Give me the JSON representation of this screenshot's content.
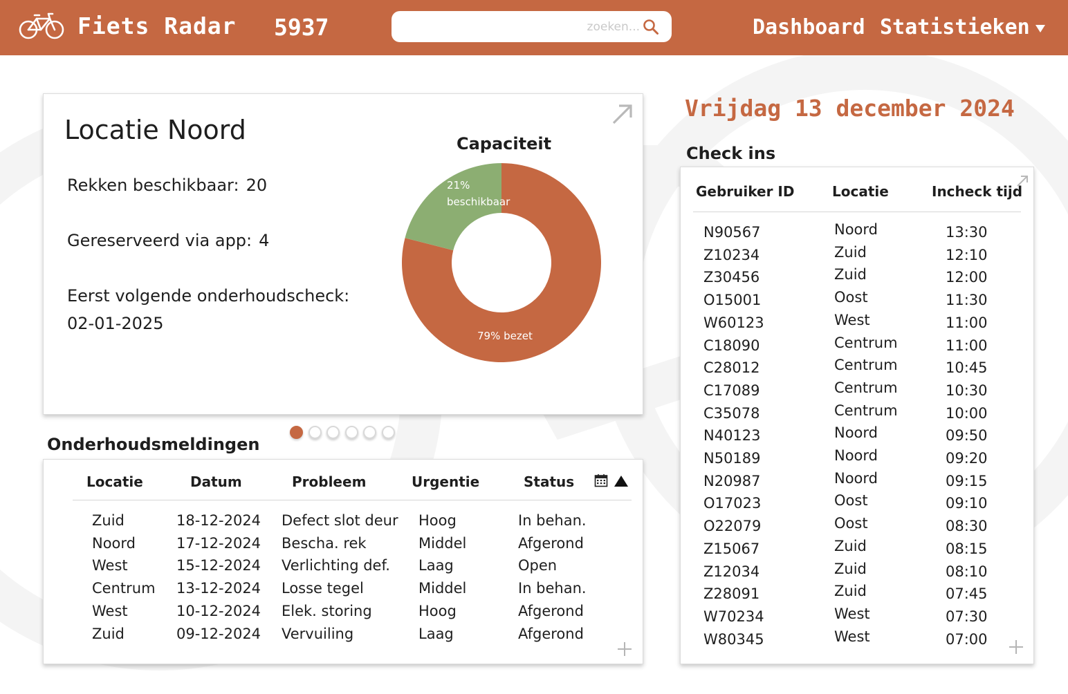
{
  "header": {
    "app_title": "Fiets Radar",
    "code": "5937",
    "search_placeholder": "zoeken...",
    "nav": {
      "dashboard": "Dashboard",
      "statistics": "Statistieken"
    },
    "logo_icon": "bicycle-icon",
    "search_icon": "magnifier-icon"
  },
  "colors": {
    "brand": "#c56842",
    "available": "#8cae72",
    "text": "#1e1e1e"
  },
  "date_heading": "Vrijdag 13 december 2024",
  "location_card": {
    "title": "Locatie Noord",
    "racks_label": "Rekken beschikbaar:",
    "racks_value": "20",
    "reserved_label": "Gereserveerd via app:",
    "reserved_value": "4",
    "maintenance_label": "Eerst volgende onderhoudscheck:",
    "maintenance_date": "02-01-2025",
    "carousel_pages": 6,
    "carousel_active_index": 0
  },
  "chart_data": {
    "type": "pie",
    "title": "Capaciteit",
    "slices": [
      {
        "label": "beschikbaar",
        "value": 21,
        "display_pct": "21%",
        "display_label": "beschikbaar",
        "color": "#8cae72"
      },
      {
        "label": "bezet",
        "value": 79,
        "display_label": "79% bezet",
        "color": "#c56842"
      }
    ]
  },
  "maintenance": {
    "title": "Onderhoudsmeldingen",
    "columns": [
      "Locatie",
      "Datum",
      "Probleem",
      "Urgentie",
      "Status"
    ],
    "rows": [
      [
        "Zuid",
        "18-12-2024",
        "Defect slot deur",
        "Hoog",
        "In behan."
      ],
      [
        "Noord",
        "17-12-2024",
        "Bescha. rek",
        "Middel",
        "Afgerond"
      ],
      [
        "West",
        "15-12-2024",
        "Verlichting def.",
        "Laag",
        "Open"
      ],
      [
        "Centrum",
        "13-12-2024",
        "Losse tegel",
        "Middel",
        "In behan."
      ],
      [
        "West",
        "10-12-2024",
        "Elek. storing",
        "Hoog",
        "Afgerond"
      ],
      [
        "Zuid",
        "09-12-2024",
        "Vervuiling",
        "Laag",
        "Afgerond"
      ]
    ]
  },
  "checkins": {
    "title": "Check ins",
    "columns": [
      "Gebruiker ID",
      "Locatie",
      "Incheck tijd"
    ],
    "rows": [
      [
        "N90567",
        "Noord",
        "13:30"
      ],
      [
        "Z10234",
        "Zuid",
        "12:10"
      ],
      [
        "Z30456",
        "Zuid",
        "12:00"
      ],
      [
        "O15001",
        "Oost",
        "11:30"
      ],
      [
        "W60123",
        "West",
        "11:00"
      ],
      [
        "C18090",
        "Centrum",
        "11:00"
      ],
      [
        "C28012",
        "Centrum",
        "10:45"
      ],
      [
        "C17089",
        "Centrum",
        "10:30"
      ],
      [
        "C35078",
        "Centrum",
        "10:00"
      ],
      [
        "N40123",
        "Noord",
        "09:50"
      ],
      [
        "N50189",
        "Noord",
        "09:20"
      ],
      [
        "N20987",
        "Noord",
        "09:15"
      ],
      [
        "O17023",
        "Oost",
        "09:10"
      ],
      [
        "O22079",
        "Oost",
        "08:30"
      ],
      [
        "Z15067",
        "Zuid",
        "08:15"
      ],
      [
        "Z12034",
        "Zuid",
        "08:10"
      ],
      [
        "Z28091",
        "Zuid",
        "07:45"
      ],
      [
        "W70234",
        "West",
        "07:30"
      ],
      [
        "W80345",
        "West",
        "07:00"
      ]
    ]
  }
}
